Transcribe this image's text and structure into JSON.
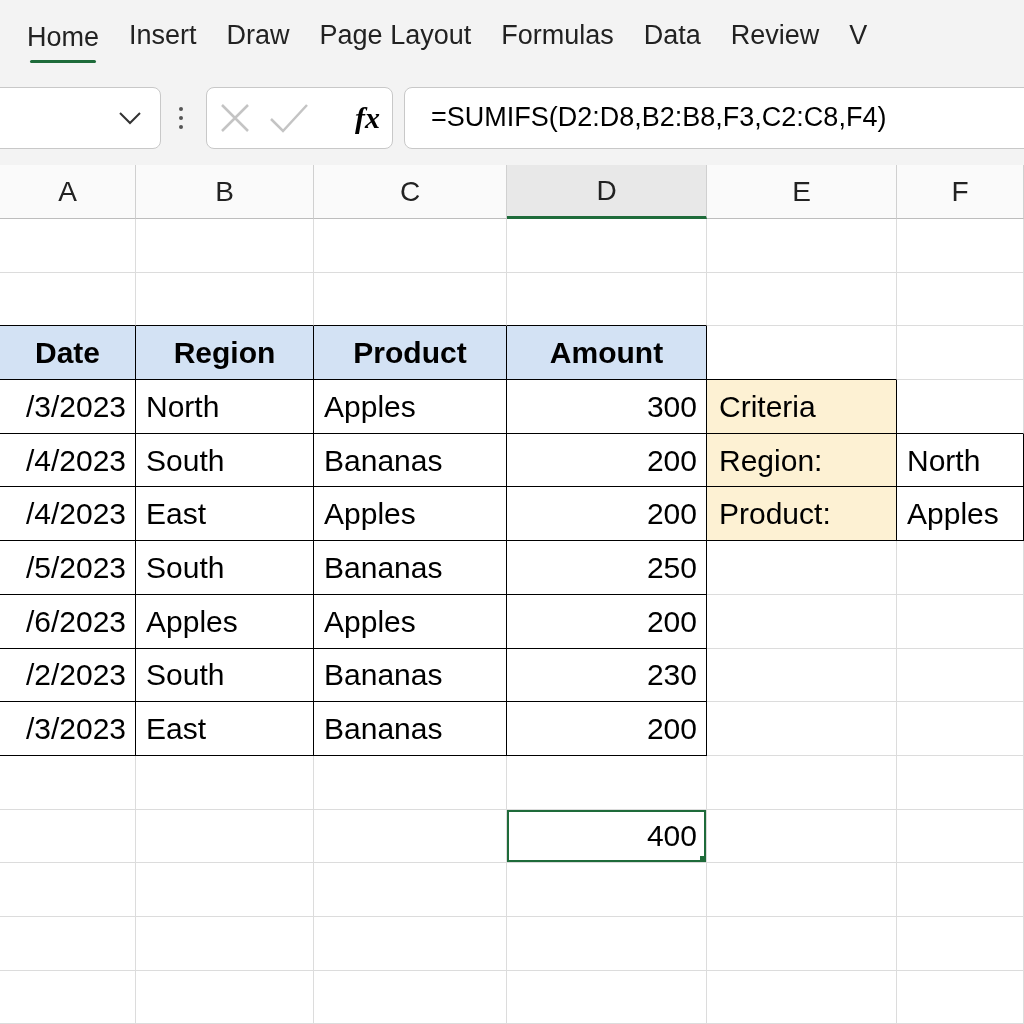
{
  "ribbon_tabs": [
    {
      "label": "Home",
      "selected": true
    },
    {
      "label": "Insert",
      "selected": false
    },
    {
      "label": "Draw",
      "selected": false
    },
    {
      "label": "Page Layout",
      "selected": false
    },
    {
      "label": "Formulas",
      "selected": false
    },
    {
      "label": "Data",
      "selected": false
    },
    {
      "label": "Review",
      "selected": false
    },
    {
      "label": "V",
      "selected": false
    }
  ],
  "formula_bar": {
    "fx_label": "fx",
    "formula": "=SUMIFS(D2:D8,B2:B8,F3,C2:C8,F4)"
  },
  "column_headers": [
    {
      "label": "A",
      "selected": false
    },
    {
      "label": "B",
      "selected": false
    },
    {
      "label": "C",
      "selected": false
    },
    {
      "label": "D",
      "selected": true
    },
    {
      "label": "E",
      "selected": false
    },
    {
      "label": "F",
      "selected": false
    }
  ],
  "rows": [
    [
      null,
      null,
      null,
      null,
      null,
      null
    ],
    [
      null,
      null,
      null,
      null,
      null,
      null
    ],
    [
      {
        "text": "Date",
        "kind": "header"
      },
      {
        "text": "Region",
        "kind": "header"
      },
      {
        "text": "Product",
        "kind": "header"
      },
      {
        "text": "Amount",
        "kind": "header"
      },
      null,
      null
    ],
    [
      {
        "text": "/3/2023",
        "kind": "number"
      },
      {
        "text": "North",
        "kind": "text"
      },
      {
        "text": "Apples",
        "kind": "text"
      },
      {
        "text": "300",
        "kind": "number"
      },
      {
        "text": "Criteria",
        "kind": "label"
      },
      null
    ],
    [
      {
        "text": "/4/2023",
        "kind": "number"
      },
      {
        "text": "South",
        "kind": "text"
      },
      {
        "text": "Bananas",
        "kind": "text"
      },
      {
        "text": "200",
        "kind": "number"
      },
      {
        "text": "Region:",
        "kind": "label"
      },
      {
        "text": "North",
        "kind": "text"
      }
    ],
    [
      {
        "text": "/4/2023",
        "kind": "number"
      },
      {
        "text": "East",
        "kind": "text"
      },
      {
        "text": "Apples",
        "kind": "text"
      },
      {
        "text": "200",
        "kind": "number"
      },
      {
        "text": "Product:",
        "kind": "label"
      },
      {
        "text": "Apples",
        "kind": "text"
      }
    ],
    [
      {
        "text": "/5/2023",
        "kind": "number"
      },
      {
        "text": "South",
        "kind": "text"
      },
      {
        "text": "Bananas",
        "kind": "text"
      },
      {
        "text": "250",
        "kind": "number"
      },
      null,
      null
    ],
    [
      {
        "text": "/6/2023",
        "kind": "number"
      },
      {
        "text": "Apples",
        "kind": "text"
      },
      {
        "text": "Apples",
        "kind": "text"
      },
      {
        "text": "200",
        "kind": "number"
      },
      null,
      null
    ],
    [
      {
        "text": "/2/2023",
        "kind": "number"
      },
      {
        "text": "South",
        "kind": "text"
      },
      {
        "text": "Bananas",
        "kind": "text"
      },
      {
        "text": "230",
        "kind": "number"
      },
      null,
      null
    ],
    [
      {
        "text": "/3/2023",
        "kind": "number"
      },
      {
        "text": "East",
        "kind": "text"
      },
      {
        "text": "Bananas",
        "kind": "text"
      },
      {
        "text": "200",
        "kind": "number"
      },
      null,
      null
    ],
    [
      null,
      null,
      null,
      null,
      null,
      null
    ],
    [
      null,
      null,
      null,
      {
        "text": "400",
        "kind": "result",
        "selected": true
      },
      null,
      null
    ],
    [
      null,
      null,
      null,
      null,
      null,
      null
    ],
    [
      null,
      null,
      null,
      null,
      null,
      null
    ],
    [
      null,
      null,
      null,
      null,
      null,
      null
    ]
  ]
}
